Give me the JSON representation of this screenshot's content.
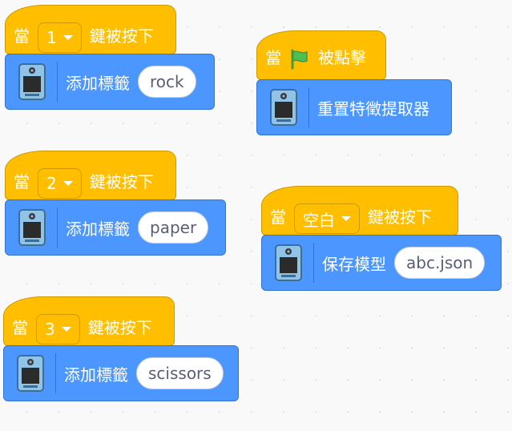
{
  "blocks": {
    "key1": {
      "when": "當",
      "key": "1",
      "pressed": "鍵被按下",
      "action": "添加標籤",
      "label": "rock"
    },
    "key2": {
      "when": "當",
      "key": "2",
      "pressed": "鍵被按下",
      "action": "添加標籤",
      "label": "paper"
    },
    "key3": {
      "when": "當",
      "key": "3",
      "pressed": "鍵被按下",
      "action": "添加標籤",
      "label": "scissors"
    },
    "flag": {
      "when": "當",
      "clicked": "被點擊",
      "action": "重置特徵提取器"
    },
    "space": {
      "when": "當",
      "key": "空白",
      "pressed": "鍵被按下",
      "action": "保存模型",
      "filename": "abc.json"
    }
  },
  "icons": {
    "extension": "ml-camera-extension-icon",
    "flag": "green-flag-icon",
    "dropdown": "chevron-down-icon"
  },
  "colors": {
    "event": "#ffbf00",
    "event_border": "#cc9900",
    "extension": "#4c97ff",
    "extension_border": "#3373cc",
    "flag": "#4cbf56"
  }
}
